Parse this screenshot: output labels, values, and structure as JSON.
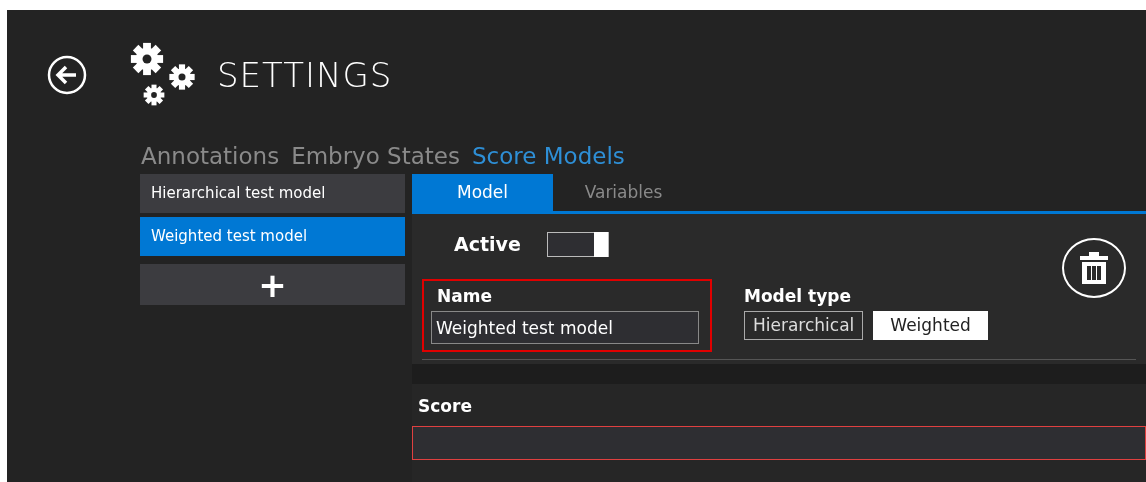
{
  "header": {
    "title": "SETTINGS"
  },
  "category_tabs": [
    {
      "label": "Annotations",
      "selected": false
    },
    {
      "label": "Embryo States",
      "selected": false
    },
    {
      "label": "Score Models",
      "selected": true
    }
  ],
  "models": [
    {
      "label": "Hierarchical test model",
      "selected": false
    },
    {
      "label": "Weighted test model",
      "selected": true
    }
  ],
  "add_button": {
    "label": "+"
  },
  "detail_tabs": [
    {
      "label": "Model",
      "selected": true
    },
    {
      "label": "Variables",
      "selected": false
    }
  ],
  "active": {
    "label": "Active",
    "on": true
  },
  "name": {
    "label": "Name",
    "value": "Weighted test model",
    "highlighted": true
  },
  "model_type": {
    "label": "Model type",
    "options": [
      {
        "label": "Hierarchical",
        "selected": false
      },
      {
        "label": "Weighted",
        "selected": true
      }
    ]
  },
  "score": {
    "label": "Score",
    "invalid": true
  }
}
